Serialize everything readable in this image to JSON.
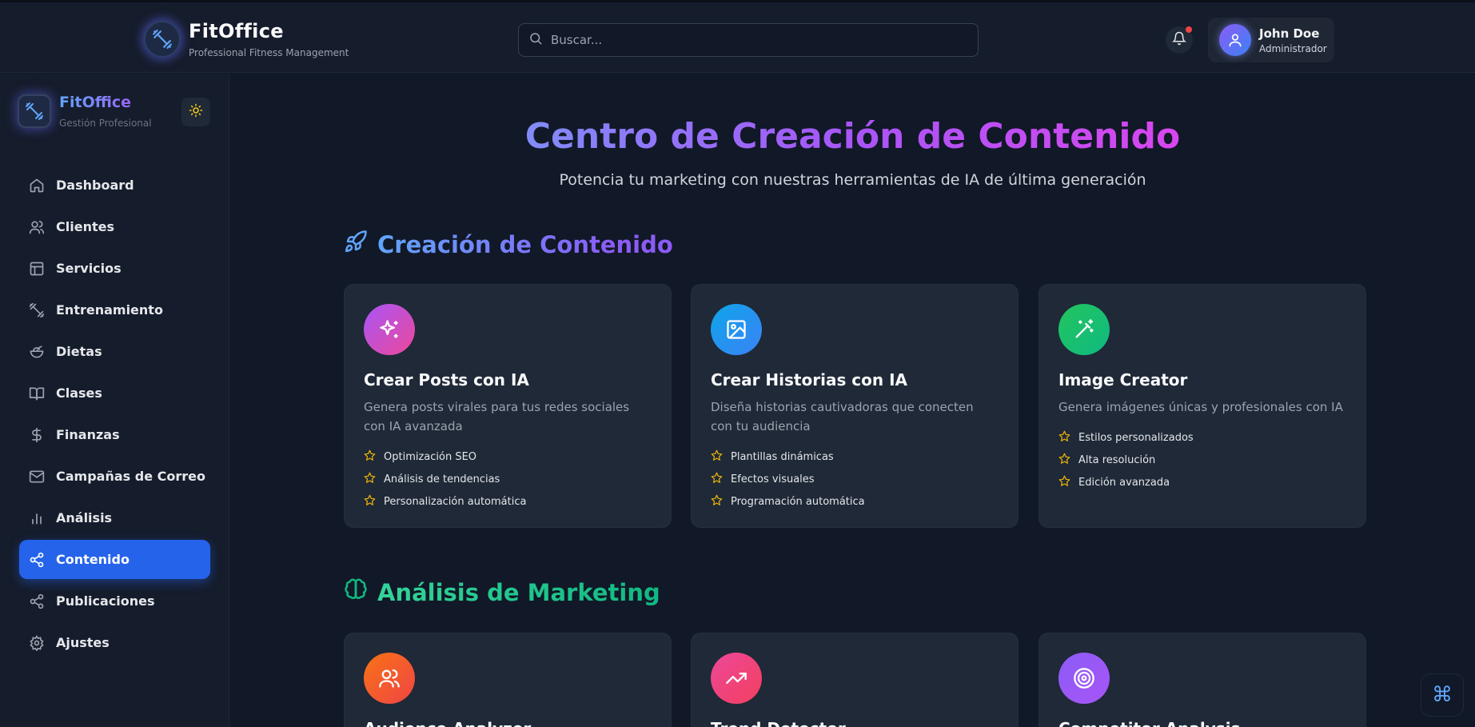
{
  "header": {
    "brand_name": "FitOffice",
    "brand_tagline": "Professional Fitness Management",
    "search_placeholder": "Buscar...",
    "notification_badge_color": "#ef4444",
    "user": {
      "name": "John Doe",
      "role": "Administrador"
    }
  },
  "sidebar": {
    "brand_name": "FitOffice",
    "brand_tagline": "Gestión Profesional",
    "theme_toggle_icon": "sun-icon",
    "items": [
      {
        "label": "Dashboard",
        "icon": "home-icon",
        "active": false
      },
      {
        "label": "Clientes",
        "icon": "users-icon",
        "active": false
      },
      {
        "label": "Servicios",
        "icon": "layout-icon",
        "active": false
      },
      {
        "label": "Entrenamiento",
        "icon": "dumbbell-icon",
        "active": false
      },
      {
        "label": "Dietas",
        "icon": "salad-icon",
        "active": false
      },
      {
        "label": "Clases",
        "icon": "book-icon",
        "active": false
      },
      {
        "label": "Finanzas",
        "icon": "dollar-icon",
        "active": false
      },
      {
        "label": "Campañas de Correo",
        "icon": "mail-icon",
        "active": false
      },
      {
        "label": "Análisis",
        "icon": "bar-chart-icon",
        "active": false
      },
      {
        "label": "Contenido",
        "icon": "share-icon",
        "active": true
      },
      {
        "label": "Publicaciones",
        "icon": "share-icon",
        "active": false
      },
      {
        "label": "Ajustes",
        "icon": "settings-icon",
        "active": false
      }
    ]
  },
  "main": {
    "title": "Centro de Creación de Contenido",
    "subtitle": "Potencia tu marketing con nuestras herramientas de IA de última generación",
    "sections": [
      {
        "title": "Creación de Contenido",
        "icon": "rocket-icon",
        "cards": [
          {
            "title": "Crear Posts con IA",
            "description": "Genera posts virales para tus redes sociales con IA avanzada",
            "icon": "sparkles-icon",
            "features": [
              "Optimización SEO",
              "Análisis de tendencias",
              "Personalización automática"
            ]
          },
          {
            "title": "Crear Historias con IA",
            "description": "Diseña historias cautivadoras que conecten con tu audiencia",
            "icon": "image-icon",
            "features": [
              "Plantillas dinámicas",
              "Efectos visuales",
              "Programación automática"
            ]
          },
          {
            "title": "Image Creator",
            "description": "Genera imágenes únicas y profesionales con IA",
            "icon": "magic-wand-icon",
            "features": [
              "Estilos personalizados",
              "Alta resolución",
              "Edición avanzada"
            ]
          }
        ]
      },
      {
        "title": "Análisis de Marketing",
        "icon": "brain-icon",
        "cards": [
          {
            "title": "Audience Analyzer",
            "icon": "users-icon"
          },
          {
            "title": "Trend Detector",
            "icon": "trending-up-icon"
          },
          {
            "title": "Competitor Analysis",
            "icon": "target-icon"
          }
        ]
      }
    ]
  },
  "command_button": {
    "label": "⌘"
  }
}
